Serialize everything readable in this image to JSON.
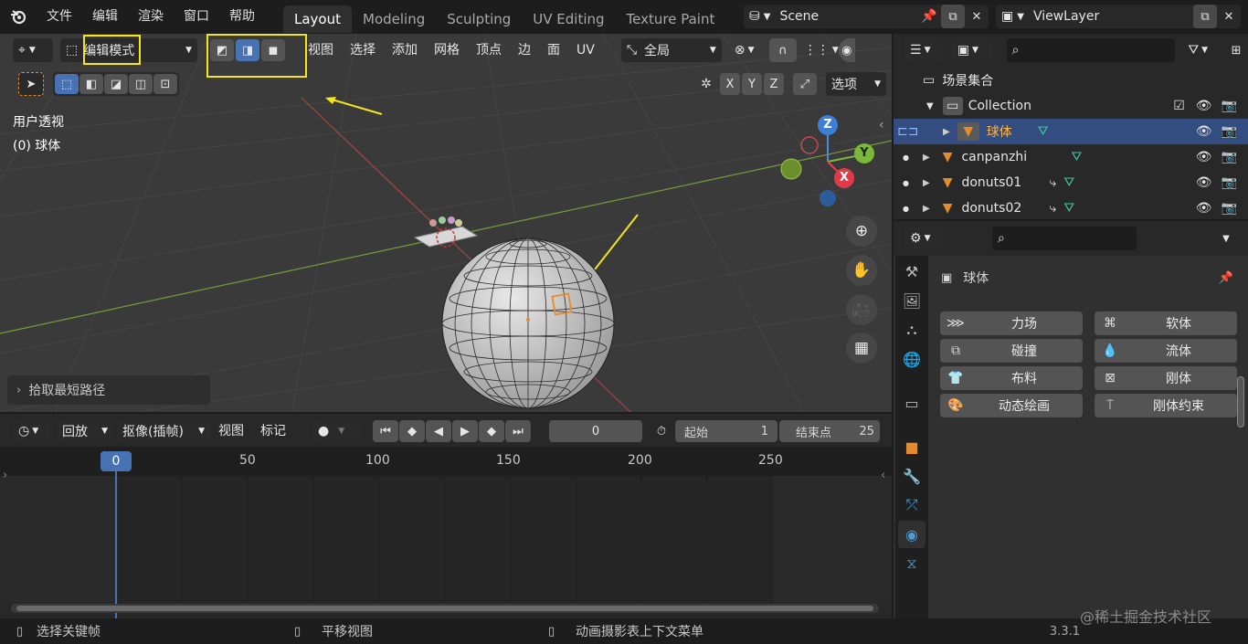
{
  "topbar": {
    "menus": [
      "文件",
      "编辑",
      "渲染",
      "窗口",
      "帮助"
    ],
    "workspaces": [
      "Layout",
      "Modeling",
      "Sculpting",
      "UV Editing",
      "Texture Paint"
    ],
    "active_workspace": "Layout",
    "scene": "Scene",
    "view_layer": "ViewLayer"
  },
  "viewport": {
    "mode": "编辑模式",
    "menus": [
      "视图",
      "选择",
      "添加",
      "网格",
      "顶点",
      "边",
      "面",
      "UV"
    ],
    "transform_orientation": "全局",
    "axes": [
      "X",
      "Y",
      "Z"
    ],
    "options_label": "选项",
    "view_name": "用户透视",
    "object_info": "(0) 球体",
    "last_op": "拾取最短路径",
    "gizmo": {
      "z": "Z",
      "y": "Y",
      "x": "X"
    }
  },
  "timeline": {
    "menus": [
      "回放",
      "抠像(插帧)",
      "视图",
      "标记"
    ],
    "current_frame": "0",
    "start_label": "起始",
    "start_value": "1",
    "end_label": "结束点",
    "end_value": "25",
    "ruler": [
      "50",
      "100",
      "150",
      "200",
      "250"
    ],
    "playhead": "0"
  },
  "outliner": {
    "root": "场景集合",
    "collection": "Collection",
    "items": [
      {
        "name": "球体",
        "selected": true
      },
      {
        "name": "canpanzhi",
        "selected": false
      },
      {
        "name": "donuts01",
        "selected": false
      },
      {
        "name": "donuts02",
        "selected": false
      }
    ]
  },
  "properties": {
    "object_name": "球体",
    "physics_buttons": [
      "力场",
      "软体",
      "碰撞",
      "流体",
      "布料",
      "刚体",
      "动态绘画",
      "刚体约束"
    ]
  },
  "statusbar": {
    "items": [
      "选择关键帧",
      "平移视图",
      "动画摄影表上下文菜单"
    ],
    "watermark": "@稀土掘金技术社区",
    "version": "3.3.1"
  },
  "colors": {
    "accent_blue": "#4772b3",
    "selection_yellow": "#f5e51e",
    "selected_row": "#334d80",
    "object_orange": "#e68a2e",
    "mesh_green": "#3cc8a0"
  }
}
